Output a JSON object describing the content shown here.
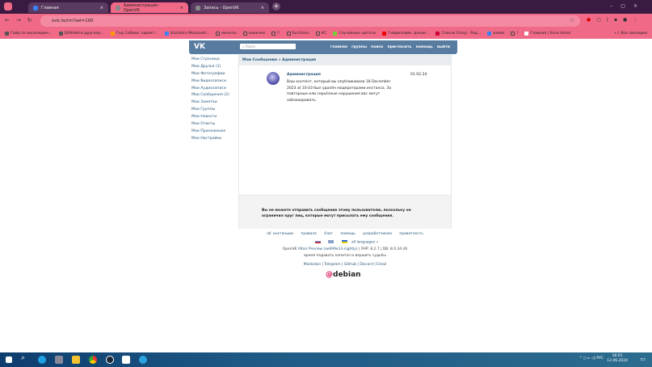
{
  "browser": {
    "tabs": [
      {
        "label": "Главная"
      },
      {
        "label": "Администрация - OpenVK"
      },
      {
        "label": "Запись - OpenVK"
      }
    ],
    "url": "ovk.to/im?sel=100",
    "bookmarks": [
      "Гайд по восхожден...",
      "Q/AНайти другому...",
      "Год Собаки: характ...",
      "Izzzzleira Mozzarell...",
      "монеты",
      "хомячки",
      "!!",
      "functions",
      "КС",
      "Случайные цитаты",
      "Гейдизлайн: делае...",
      "Список Emoji : Род...",
      "влево",
      "!",
      "Главная | Sicre Imrez"
    ],
    "all_bookmarks": "Все закладки"
  },
  "vk": {
    "search_placeholder": "Поиск",
    "nav": [
      "главная",
      "группы",
      "поиск",
      "пригласить",
      "помощь",
      "выйти"
    ],
    "menu": [
      "Мои Страница",
      "Мои Друзья (1)",
      "Мои Фотографии",
      "Мои Видеозаписи",
      "Мои Аудиозаписи",
      "Мои Сообщения (2)",
      "Мои Заметки",
      "Мои Группы",
      "Мои Новости",
      "Мои Ответы",
      "Мои Приложения",
      "Мои Настройки"
    ],
    "breadcrumb": "Мои Сообщения » Администрация",
    "message": {
      "sender": "Администрация",
      "text": "Ваш контент, который вы опубликовали 18 December 2023 at 10:43 был удалён модераторами инстанса. За повторные или серьёзные нарушения вас могут заблокировать.",
      "date": "01.02.24"
    },
    "notice": "Вы не можете отправить сообщение этому пользователю, поскольку он ограничил круг лиц, которые могут присылать ему сообщения.",
    "footer_links": [
      "об инстанции",
      "правила",
      "блог",
      "помощь",
      "разработчикам",
      "приватность"
    ],
    "languages": "all languages »",
    "version_prefix": "OpenVK",
    "version_link": "Altair Preview (ae699e13-nightly)",
    "version_suffix": "| PHP: 8.2.7 | DB: 8.0.34-26",
    "slogan": "время подавать капитал и вершить судьбы",
    "social": [
      "Mastodon",
      "Telegram",
      "GitHub",
      "Discord",
      "Email"
    ],
    "debian": "debian"
  },
  "taskbar": {
    "lang": "РУС",
    "time": "16:01",
    "date": "12.06.2024"
  }
}
